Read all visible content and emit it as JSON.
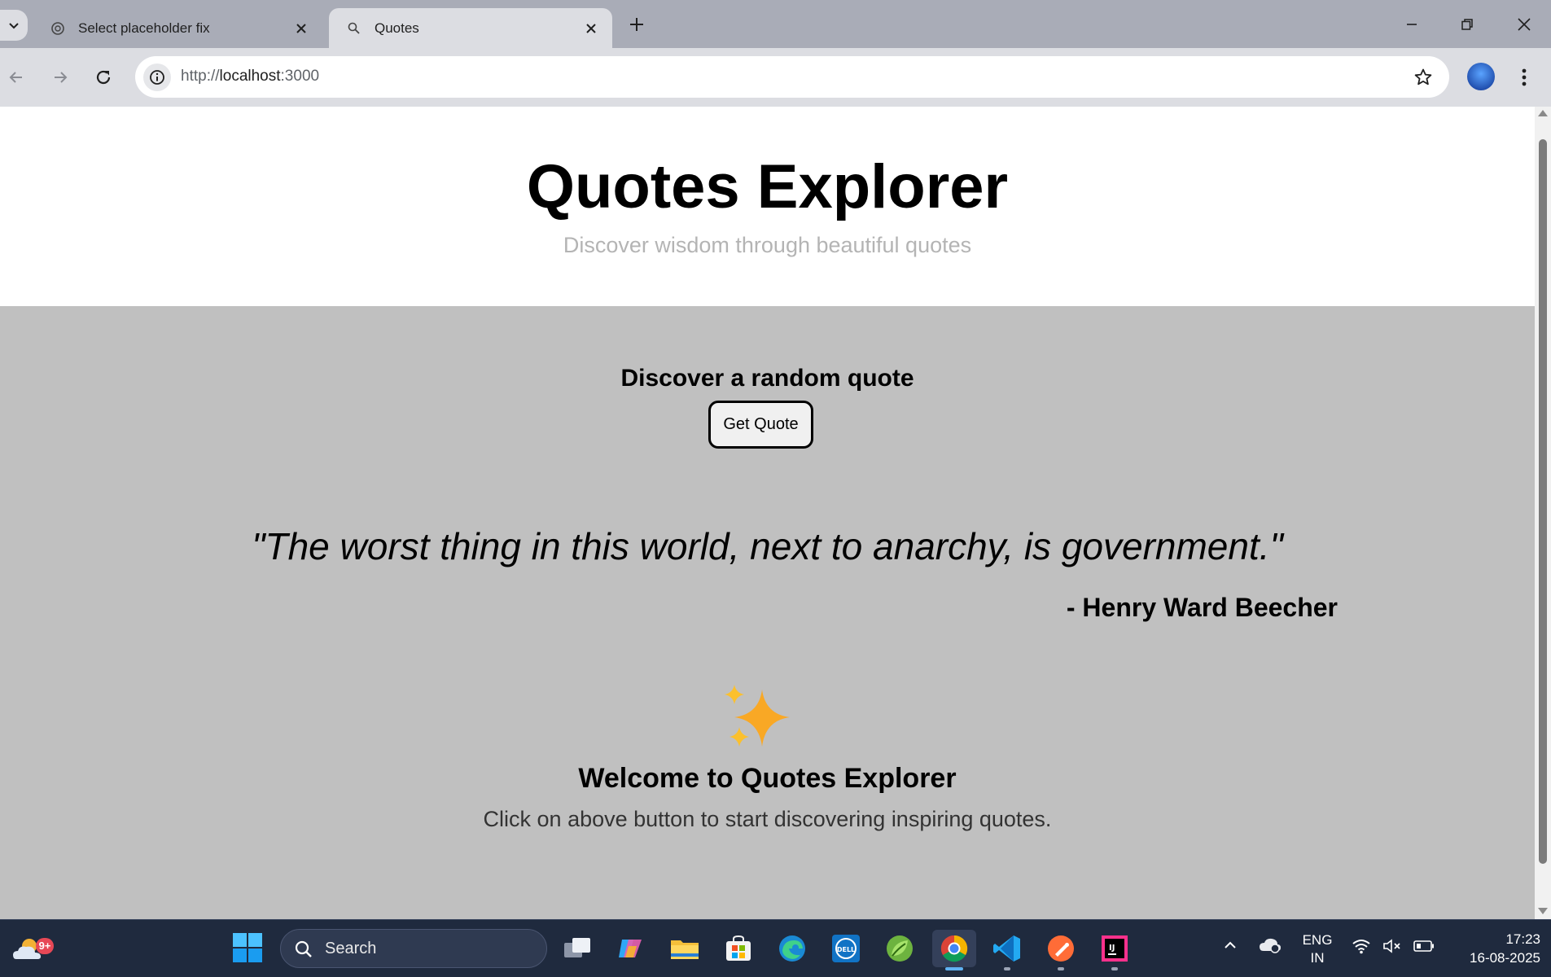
{
  "browser": {
    "tabs": [
      {
        "title": "Select placeholder fix",
        "active": false
      },
      {
        "title": "Quotes",
        "active": true
      }
    ],
    "url": {
      "scheme": "http://",
      "host": "localhost",
      "port": ":3000"
    }
  },
  "page": {
    "title": "Quotes Explorer",
    "subtitle": "Discover wisdom through beautiful quotes",
    "discover_heading": "Discover a random quote",
    "get_quote_label": "Get Quote",
    "quote": "\"The worst thing in this world, next to anarchy, is government.\"",
    "author": "- Henry Ward Beecher",
    "welcome_title": "Welcome to Quotes Explorer",
    "welcome_text": "Click on above button to start discovering inspiring quotes."
  },
  "taskbar": {
    "weather_badge": "9+",
    "search_label": "Search",
    "language": {
      "line1": "ENG",
      "line2": "IN"
    },
    "time": "17:23",
    "date": "16-08-2025"
  },
  "colors": {
    "page_background": "#c0c0c0",
    "header_background": "#ffffff",
    "subtitle": "#b4b4b4",
    "sparkle": "#f9a825"
  }
}
